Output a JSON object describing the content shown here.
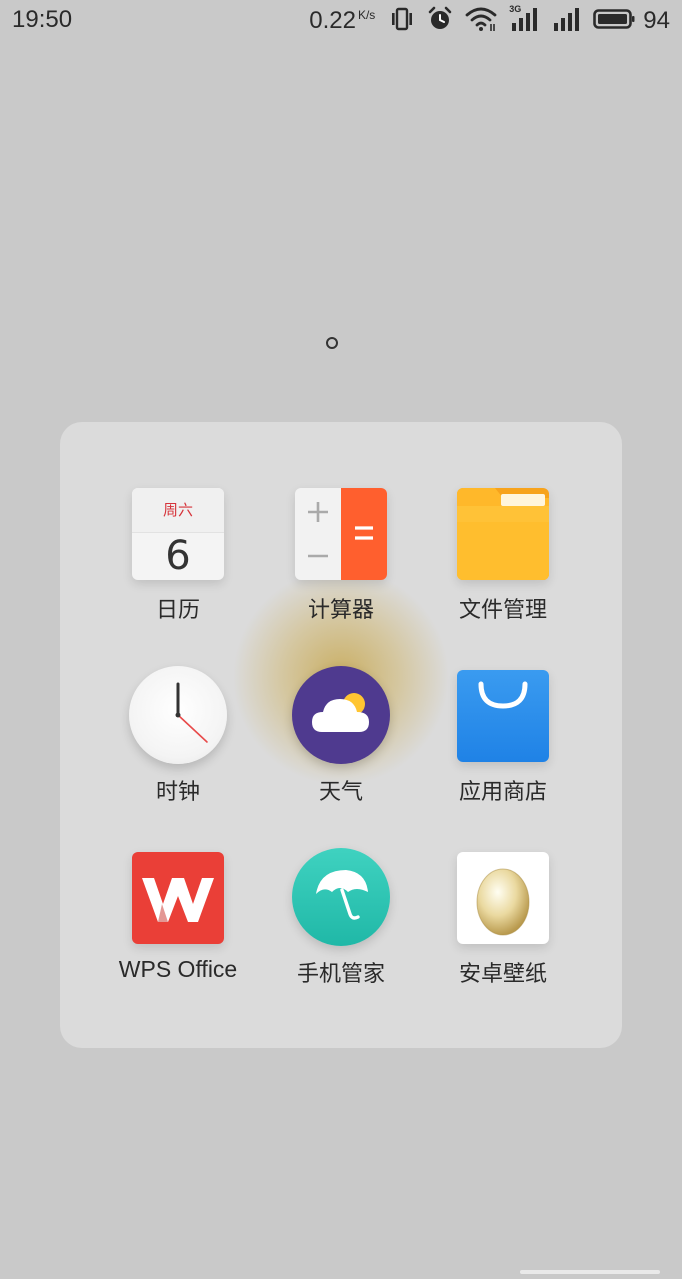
{
  "status_bar": {
    "time": "19:50",
    "net_speed": "0.22",
    "net_unit": "K/s",
    "network_type": "3G",
    "battery_level": "94"
  },
  "folder": {
    "title": "。",
    "apps": [
      {
        "label": "日历",
        "icon": "calendar-icon",
        "cal_weekday": "周六",
        "cal_day": "6"
      },
      {
        "label": "计算器",
        "icon": "calculator-icon"
      },
      {
        "label": "文件管理",
        "icon": "folder-icon"
      },
      {
        "label": "时钟",
        "icon": "clock-icon"
      },
      {
        "label": "天气",
        "icon": "weather-icon"
      },
      {
        "label": "应用商店",
        "icon": "app-store-icon"
      },
      {
        "label": "WPS Office",
        "icon": "wps-icon"
      },
      {
        "label": "手机管家",
        "icon": "umbrella-icon"
      },
      {
        "label": "安卓壁纸",
        "icon": "egg-icon"
      }
    ]
  },
  "colors": {
    "background": "#c9c9c9",
    "folder_panel": "#dbdbdb",
    "calculator_accent": "#ff5f2e",
    "weather_bg": "#4f3a8f",
    "store_blue": "#1f82e6",
    "wps_red": "#ea3f37",
    "manager_teal": "#20b8a7"
  }
}
